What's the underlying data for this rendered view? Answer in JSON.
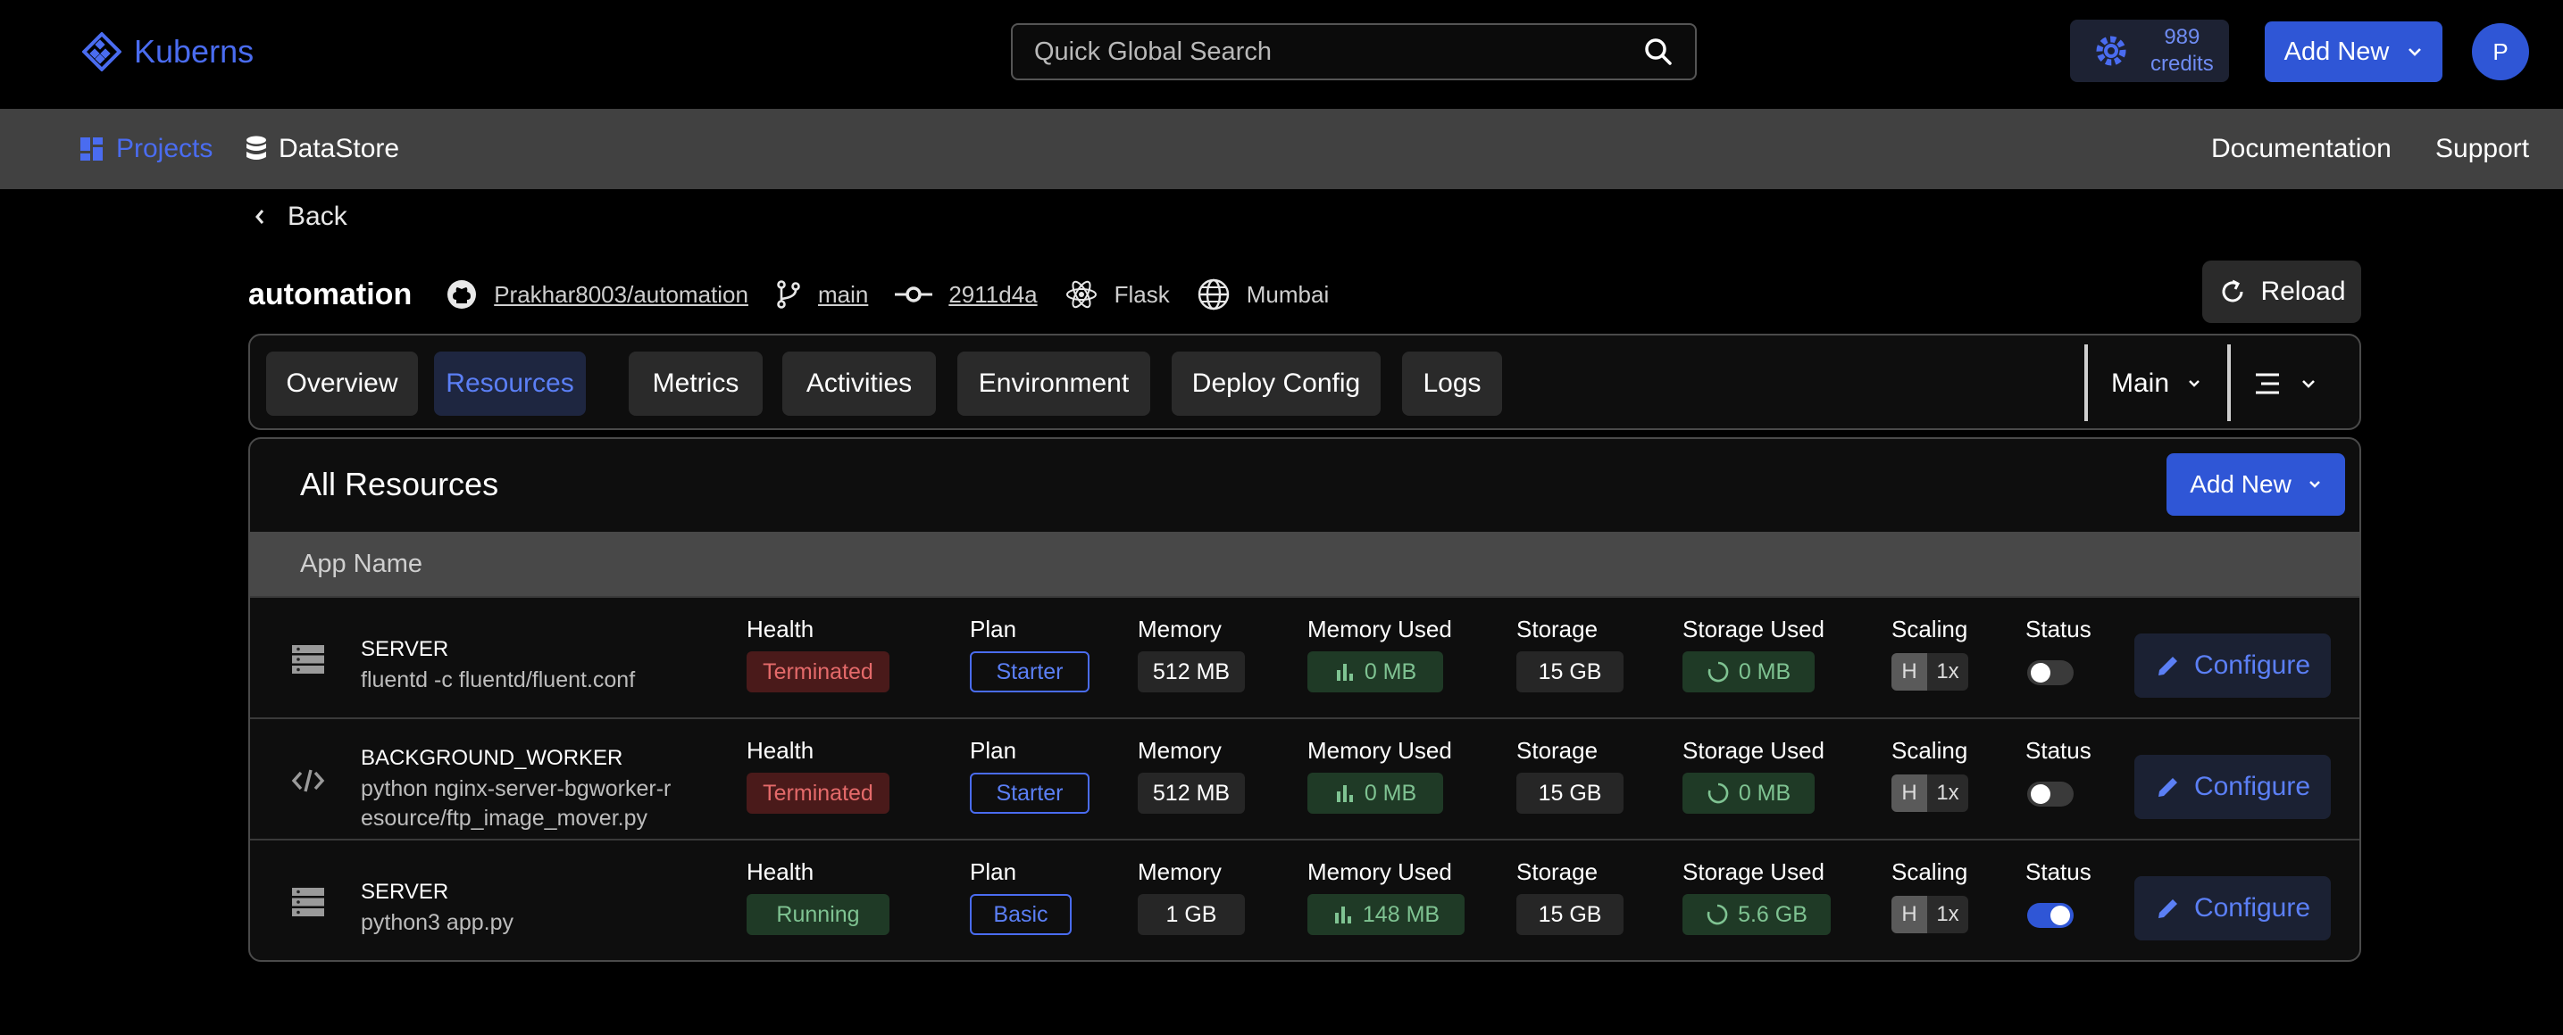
{
  "brand": {
    "name": "Kuberns"
  },
  "search": {
    "placeholder": "Quick Global Search"
  },
  "credits": {
    "amount": "989",
    "label": "credits"
  },
  "header": {
    "add_new": "Add New",
    "avatar_initial": "P"
  },
  "nav": {
    "projects": "Projects",
    "datastore": "DataStore",
    "documentation": "Documentation",
    "support": "Support"
  },
  "back": "Back",
  "project": {
    "name": "automation",
    "repo": "Prakhar8003/automation",
    "branch": "main",
    "commit": "2911d4a",
    "framework": "Flask",
    "region": "Mumbai",
    "reload": "Reload"
  },
  "tabs": [
    {
      "label": "Overview"
    },
    {
      "label": "Resources"
    },
    {
      "label": "Metrics"
    },
    {
      "label": "Activities"
    },
    {
      "label": "Environment"
    },
    {
      "label": "Deploy Config"
    },
    {
      "label": "Logs"
    }
  ],
  "active_tab": "Resources",
  "environment_select": "Main",
  "resources": {
    "title": "All Resources",
    "add_new": "Add New",
    "column_header": "App Name",
    "labels": {
      "health": "Health",
      "plan": "Plan",
      "memory": "Memory",
      "memory_used": "Memory Used",
      "storage": "Storage",
      "storage_used": "Storage Used",
      "scaling": "Scaling",
      "status": "Status",
      "configure": "Configure",
      "scaling_h": "H"
    },
    "rows": [
      {
        "type": "SERVER",
        "command": "fluentd -c fluentd/fluent.conf",
        "health": "Terminated",
        "plan": "Starter",
        "memory": "512 MB",
        "memory_used": "0 MB",
        "storage": "15 GB",
        "storage_used": "0 MB",
        "scaling": "1x",
        "status_on": false
      },
      {
        "type": "BACKGROUND_WORKER",
        "command": "python nginx-server-bgworker-resource/ftp_image_mover.py",
        "command_line1": "python nginx-server-bgworker-r",
        "command_line2": "esource/ftp_image_mover.py",
        "health": "Terminated",
        "plan": "Starter",
        "memory": "512 MB",
        "memory_used": "0 MB",
        "storage": "15 GB",
        "storage_used": "0 MB",
        "scaling": "1x",
        "status_on": false
      },
      {
        "type": "SERVER",
        "command": "python3 app.py",
        "health": "Running",
        "plan": "Basic",
        "memory": "1 GB",
        "memory_used": "148 MB",
        "storage": "15 GB",
        "storage_used": "5.6 GB",
        "scaling": "1x",
        "status_on": true
      }
    ]
  },
  "colors": {
    "accent": "#2f56d6",
    "accent_text": "#4a6cf0",
    "terminated": "#e46a6a",
    "running": "#7fc392"
  }
}
